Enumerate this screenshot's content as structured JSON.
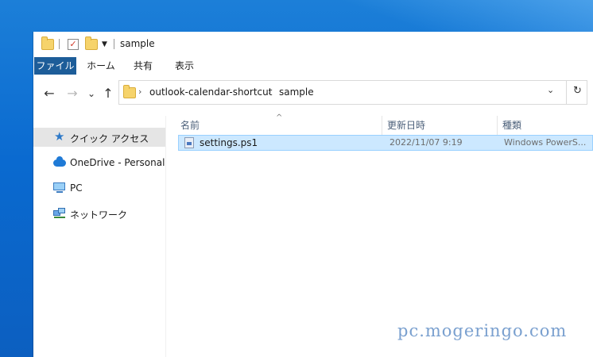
{
  "window": {
    "title": "sample"
  },
  "ribbon": {
    "tabs": [
      {
        "label": "ファイル"
      },
      {
        "label": "ホーム"
      },
      {
        "label": "共有"
      },
      {
        "label": "表示"
      }
    ]
  },
  "navigation": {
    "back": "←",
    "forward": "→",
    "recent": "⌄",
    "up": "↑"
  },
  "address": {
    "crumbs": [
      "outlook-calendar-shortcut",
      "sample"
    ],
    "separator": "›",
    "dropdown": "⌄",
    "refresh": "↻"
  },
  "nav_pane": {
    "items": [
      {
        "label": "クイック アクセス",
        "icon": "star-icon",
        "selected": true
      },
      {
        "label": "OneDrive - Personal",
        "icon": "cloud-icon"
      },
      {
        "label": "PC",
        "icon": "computer-icon"
      },
      {
        "label": "ネットワーク",
        "icon": "network-icon"
      }
    ]
  },
  "columns": {
    "name": "名前",
    "date": "更新日時",
    "type": "種類",
    "sort": "^"
  },
  "files": [
    {
      "name": "settings.ps1",
      "date": "2022/11/07 9:19",
      "type": "Windows PowerS..."
    }
  ],
  "watermark": "pc.mogeringo.com"
}
